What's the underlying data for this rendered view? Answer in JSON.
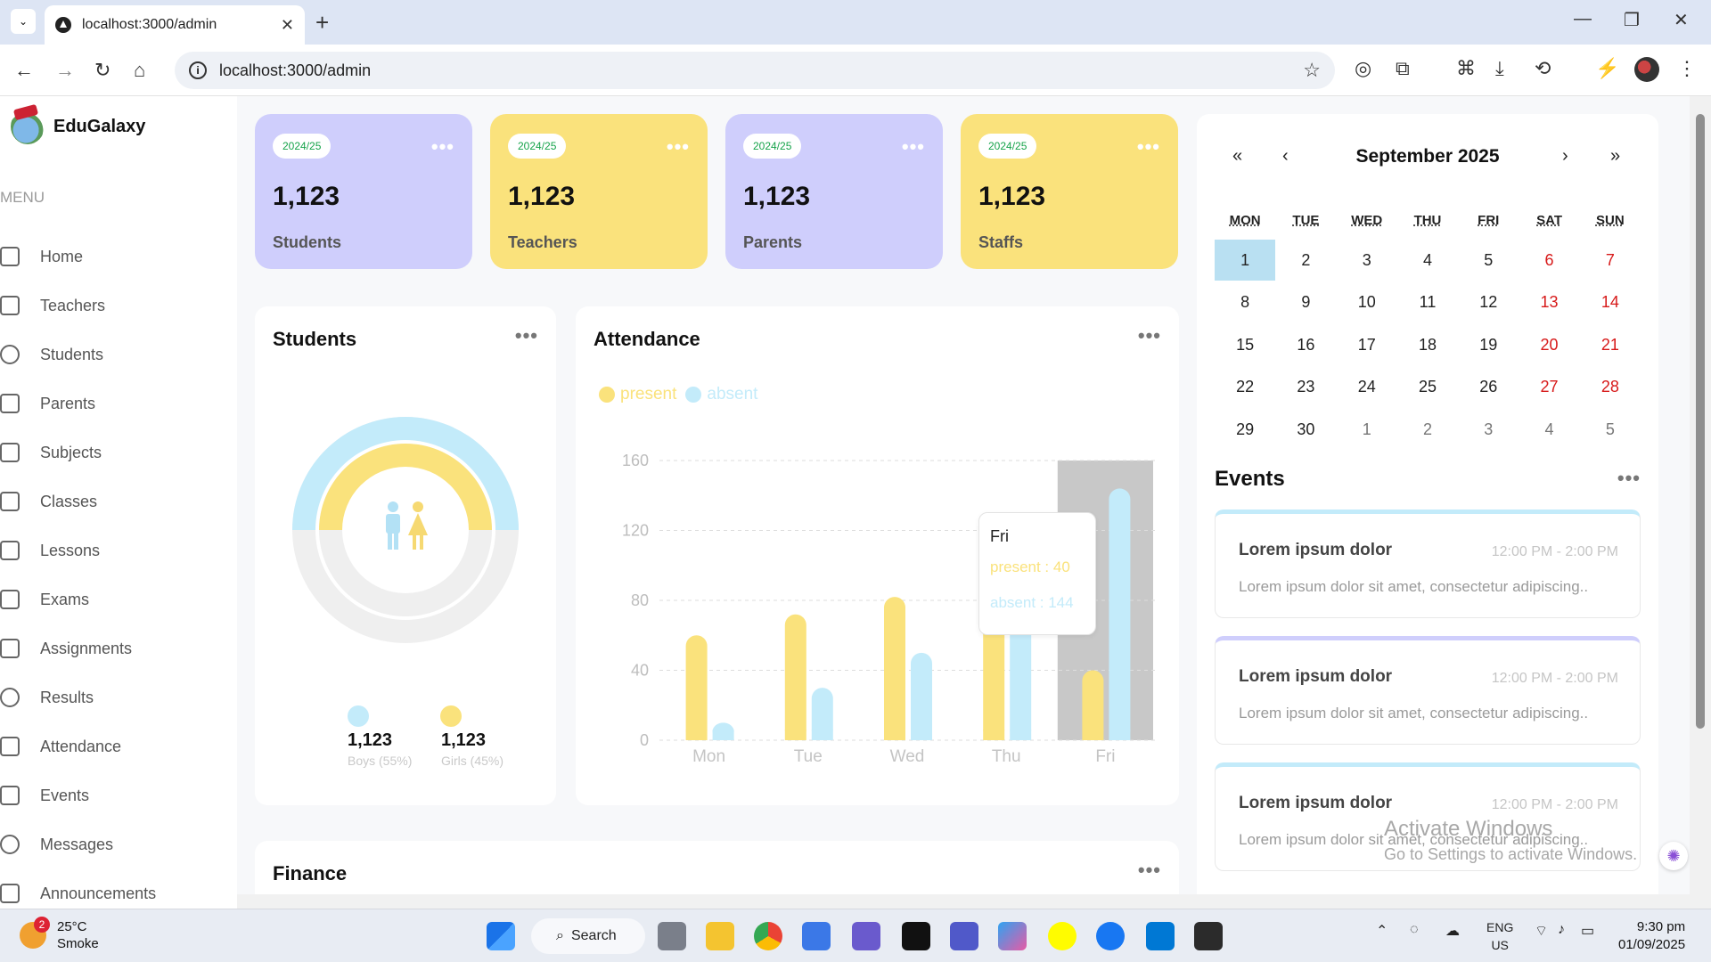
{
  "browser": {
    "tab_title": "localhost:3000/admin",
    "url": "localhost:3000/admin"
  },
  "app": {
    "name": "EduGalaxy"
  },
  "menu": {
    "title": "MENU",
    "items": [
      {
        "label": "Home",
        "icon": "home-icon"
      },
      {
        "label": "Teachers",
        "icon": "graduation-cap-icon"
      },
      {
        "label": "Students",
        "icon": "users-icon"
      },
      {
        "label": "Parents",
        "icon": "family-icon"
      },
      {
        "label": "Subjects",
        "icon": "book-icon"
      },
      {
        "label": "Classes",
        "icon": "class-icon"
      },
      {
        "label": "Lessons",
        "icon": "lesson-icon"
      },
      {
        "label": "Exams",
        "icon": "exam-icon"
      },
      {
        "label": "Assignments",
        "icon": "assignment-icon"
      },
      {
        "label": "Results",
        "icon": "results-icon"
      },
      {
        "label": "Attendance",
        "icon": "attendance-icon"
      },
      {
        "label": "Events",
        "icon": "calendar-icon"
      },
      {
        "label": "Messages",
        "icon": "message-icon"
      },
      {
        "label": "Announcements",
        "icon": "megaphone-icon"
      }
    ]
  },
  "stats": [
    {
      "badge": "2024/25",
      "value": "1,123",
      "label": "Students",
      "color": "#cfcefc"
    },
    {
      "badge": "2024/25",
      "value": "1,123",
      "label": "Teachers",
      "color": "#fae27c"
    },
    {
      "badge": "2024/25",
      "value": "1,123",
      "label": "Parents",
      "color": "#cfcefc"
    },
    {
      "badge": "2024/25",
      "value": "1,123",
      "label": "Staffs",
      "color": "#fae27c"
    }
  ],
  "students_panel": {
    "title": "Students",
    "boys": {
      "value": "1,123",
      "label": "Boys (55%)",
      "color": "#c3ebfa"
    },
    "girls": {
      "value": "1,123",
      "label": "Girls (45%)",
      "color": "#fae27c"
    }
  },
  "attendance_panel": {
    "title": "Attendance",
    "legend_present": "present",
    "legend_absent": "absent",
    "tooltip": {
      "day": "Fri",
      "present": "present : 40",
      "absent": "absent : 144"
    }
  },
  "chart_data": {
    "type": "bar",
    "categories": [
      "Mon",
      "Tue",
      "Wed",
      "Thu",
      "Fri"
    ],
    "series": [
      {
        "name": "present",
        "values": [
          60,
          72,
          82,
          80,
          40
        ],
        "color": "#fae27c"
      },
      {
        "name": "absent",
        "values": [
          10,
          30,
          50,
          70,
          144
        ],
        "color": "#c3ebfa"
      }
    ],
    "ylim": [
      0,
      160
    ],
    "yticks": [
      0,
      40,
      80,
      120,
      160
    ],
    "grid": true,
    "legend": "top-left",
    "highlight": "Fri"
  },
  "finance_panel": {
    "title": "Finance"
  },
  "calendar": {
    "prev_year": "«",
    "prev_month": "‹",
    "next_month": "›",
    "next_year": "»",
    "title": "September 2025",
    "weekdays": [
      "MON",
      "TUE",
      "WED",
      "THU",
      "FRI",
      "SAT",
      "SUN"
    ],
    "weeks": [
      [
        "1",
        "2",
        "3",
        "4",
        "5",
        "6",
        "7"
      ],
      [
        "8",
        "9",
        "10",
        "11",
        "12",
        "13",
        "14"
      ],
      [
        "15",
        "16",
        "17",
        "18",
        "19",
        "20",
        "21"
      ],
      [
        "22",
        "23",
        "24",
        "25",
        "26",
        "27",
        "28"
      ],
      [
        "29",
        "30",
        "1",
        "2",
        "3",
        "4",
        "5"
      ]
    ],
    "today": "1"
  },
  "events": {
    "title": "Events",
    "items": [
      {
        "title": "Lorem ipsum dolor",
        "time": "12:00 PM - 2:00 PM",
        "desc": "Lorem ipsum dolor sit amet, consectetur adipiscing..",
        "accent": "#c3ebfa"
      },
      {
        "title": "Lorem ipsum dolor",
        "time": "12:00 PM - 2:00 PM",
        "desc": "Lorem ipsum dolor sit amet, consectetur adipiscing..",
        "accent": "#cfcefc"
      },
      {
        "title": "Lorem ipsum dolor",
        "time": "12:00 PM - 2:00 PM",
        "desc": "Lorem ipsum dolor sit amet, consectetur adipiscing..",
        "accent": "#c3ebfa"
      }
    ]
  },
  "watermark": {
    "line1": "Activate Windows",
    "line2": "Go to Settings to activate Windows."
  },
  "taskbar": {
    "temp": "25°C",
    "weather": "Smoke",
    "weather_badge": "2",
    "search": "Search",
    "lang1": "ENG",
    "lang2": "US",
    "time": "9:30 pm",
    "date": "01/09/2025"
  }
}
